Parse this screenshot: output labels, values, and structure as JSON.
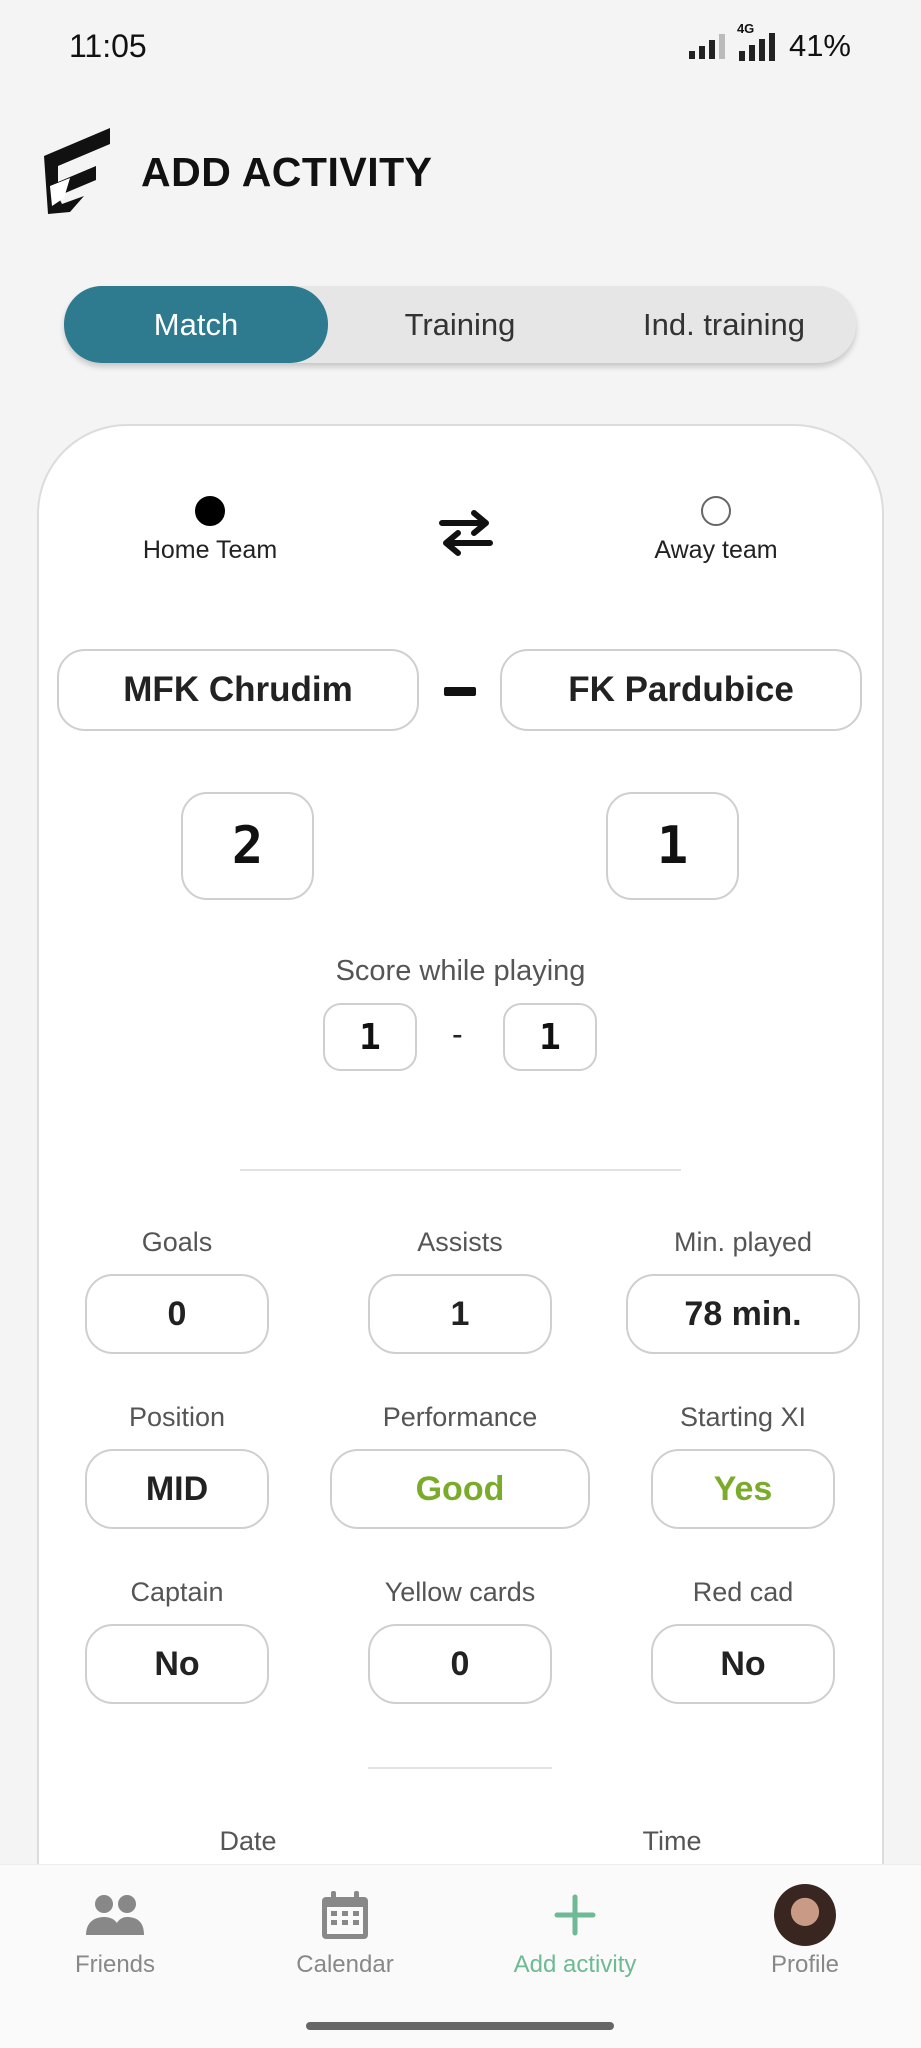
{
  "status_bar": {
    "time": "11:05",
    "network": "4G",
    "battery": "41%"
  },
  "header": {
    "title": "ADD ACTIVITY",
    "logo": "brand-logo"
  },
  "tabs": [
    {
      "label": "Match",
      "active": true
    },
    {
      "label": "Training",
      "active": false
    },
    {
      "label": "Ind. training",
      "active": false
    }
  ],
  "team_choice": {
    "home_label": "Home Team",
    "away_label": "Away team",
    "selected": "home",
    "swap_icon": "swap-arrows-icon"
  },
  "teams": {
    "home": "MFK Chrudim",
    "away": "FK Pardubice"
  },
  "final_score": {
    "home": "2",
    "away": "1"
  },
  "score_while_playing": {
    "label": "Score while playing",
    "home": "1",
    "separator": "-",
    "away": "1"
  },
  "stats": {
    "goals": {
      "label": "Goals",
      "value": "0"
    },
    "assists": {
      "label": "Assists",
      "value": "1"
    },
    "min_played": {
      "label": "Min. played",
      "value": "78 min."
    },
    "position": {
      "label": "Position",
      "value": "MID"
    },
    "performance": {
      "label": "Performance",
      "value": "Good"
    },
    "starting_xi": {
      "label": "Starting XI",
      "value": "Yes"
    },
    "captain": {
      "label": "Captain",
      "value": "No"
    },
    "yellow_cards": {
      "label": "Yellow cards",
      "value": "0"
    },
    "red_card": {
      "label": "Red cad",
      "value": "No"
    }
  },
  "date_time": {
    "date_label": "Date",
    "time_label": "Time"
  },
  "colors": {
    "accent": "#2e7a8e",
    "positive": "#7bab2a",
    "nav_active": "#6fb994"
  },
  "bottom_nav": [
    {
      "label": "Friends",
      "icon": "people-icon",
      "active": false
    },
    {
      "label": "Calendar",
      "icon": "calendar-icon",
      "active": false
    },
    {
      "label": "Add activity",
      "icon": "plus-icon",
      "active": true
    },
    {
      "label": "Profile",
      "icon": "avatar",
      "active": false
    }
  ]
}
